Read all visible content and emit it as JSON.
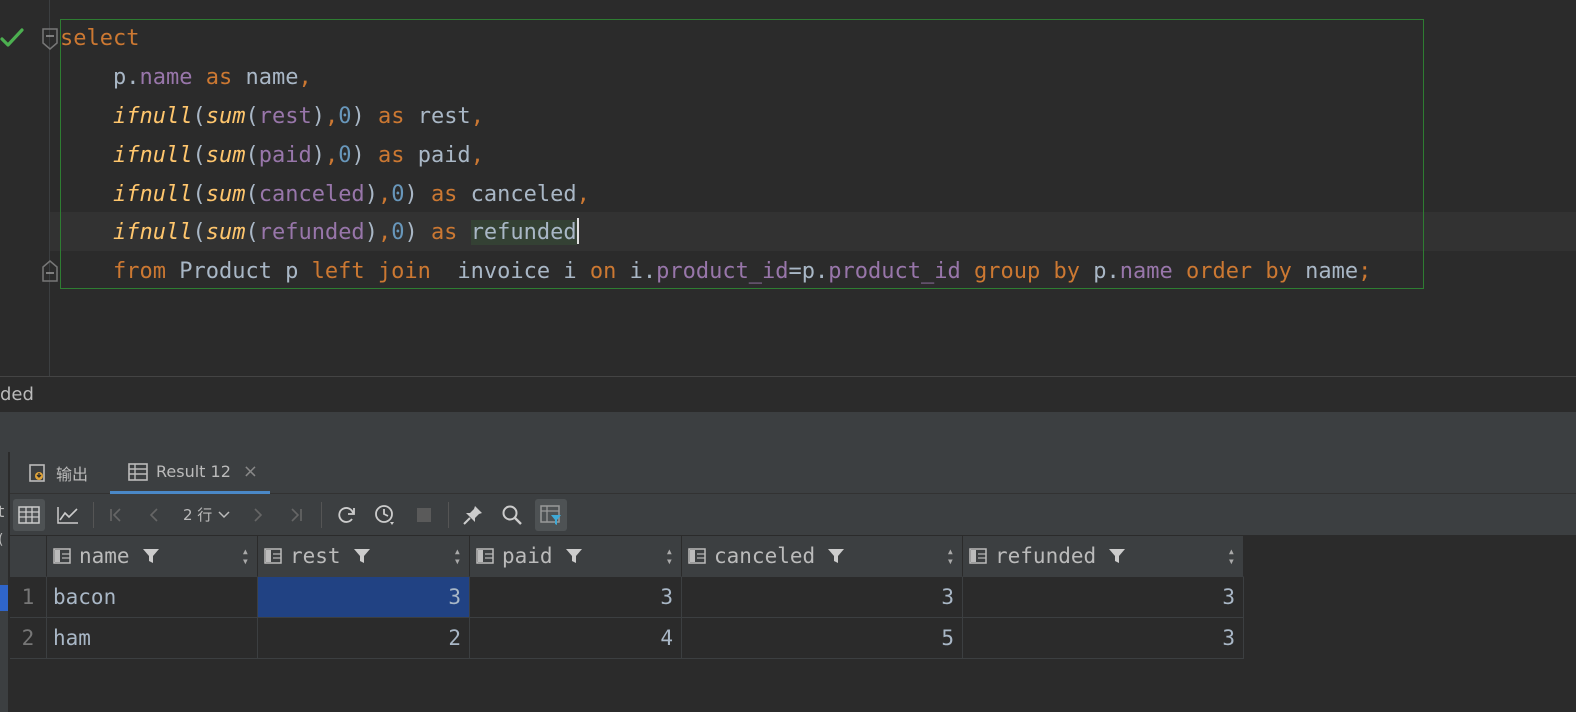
{
  "editor": {
    "status": "success",
    "lines": [
      [
        {
          "t": "select",
          "c": "kw"
        }
      ],
      [
        {
          "t": "    p.",
          "c": "pl"
        },
        {
          "t": "name",
          "c": "col"
        },
        {
          "t": " ",
          "c": "pl"
        },
        {
          "t": "as",
          "c": "kw"
        },
        {
          "t": " name",
          "c": "pl"
        },
        {
          "t": ",",
          "c": "kw"
        }
      ],
      [
        {
          "t": "    ",
          "c": "pl"
        },
        {
          "t": "ifnull",
          "c": "fn"
        },
        {
          "t": "(",
          "c": "pl"
        },
        {
          "t": "sum",
          "c": "fn"
        },
        {
          "t": "(",
          "c": "pl"
        },
        {
          "t": "rest",
          "c": "col"
        },
        {
          "t": ")",
          "c": "pl"
        },
        {
          "t": ",",
          "c": "kw"
        },
        {
          "t": "0",
          "c": "num"
        },
        {
          "t": ") ",
          "c": "pl"
        },
        {
          "t": "as",
          "c": "kw"
        },
        {
          "t": " rest",
          "c": "pl"
        },
        {
          "t": ",",
          "c": "kw"
        }
      ],
      [
        {
          "t": "    ",
          "c": "pl"
        },
        {
          "t": "ifnull",
          "c": "fn"
        },
        {
          "t": "(",
          "c": "pl"
        },
        {
          "t": "sum",
          "c": "fn"
        },
        {
          "t": "(",
          "c": "pl"
        },
        {
          "t": "paid",
          "c": "col"
        },
        {
          "t": ")",
          "c": "pl"
        },
        {
          "t": ",",
          "c": "kw"
        },
        {
          "t": "0",
          "c": "num"
        },
        {
          "t": ") ",
          "c": "pl"
        },
        {
          "t": "as",
          "c": "kw"
        },
        {
          "t": " paid",
          "c": "pl"
        },
        {
          "t": ",",
          "c": "kw"
        }
      ],
      [
        {
          "t": "    ",
          "c": "pl"
        },
        {
          "t": "ifnull",
          "c": "fn"
        },
        {
          "t": "(",
          "c": "pl"
        },
        {
          "t": "sum",
          "c": "fn"
        },
        {
          "t": "(",
          "c": "pl"
        },
        {
          "t": "canceled",
          "c": "col"
        },
        {
          "t": ")",
          "c": "pl"
        },
        {
          "t": ",",
          "c": "kw"
        },
        {
          "t": "0",
          "c": "num"
        },
        {
          "t": ") ",
          "c": "pl"
        },
        {
          "t": "as",
          "c": "kw"
        },
        {
          "t": " canceled",
          "c": "pl"
        },
        {
          "t": ",",
          "c": "kw"
        }
      ],
      [
        {
          "t": "    ",
          "c": "pl"
        },
        {
          "t": "ifnull",
          "c": "fn"
        },
        {
          "t": "(",
          "c": "pl"
        },
        {
          "t": "sum",
          "c": "fn"
        },
        {
          "t": "(",
          "c": "pl"
        },
        {
          "t": "refunded",
          "c": "col"
        },
        {
          "t": ")",
          "c": "pl"
        },
        {
          "t": ",",
          "c": "kw"
        },
        {
          "t": "0",
          "c": "num"
        },
        {
          "t": ") ",
          "c": "pl"
        },
        {
          "t": "as",
          "c": "kw"
        },
        {
          "t": " ",
          "c": "pl"
        },
        {
          "t": "refunded",
          "c": "pl hl"
        },
        {
          "t": "|",
          "c": "caret"
        }
      ],
      [
        {
          "t": "    ",
          "c": "pl"
        },
        {
          "t": "from",
          "c": "kw"
        },
        {
          "t": " Product p ",
          "c": "pl"
        },
        {
          "t": "left join",
          "c": "kw"
        },
        {
          "t": "  invoice i ",
          "c": "pl"
        },
        {
          "t": "on",
          "c": "kw"
        },
        {
          "t": " i.",
          "c": "pl"
        },
        {
          "t": "product_id",
          "c": "col"
        },
        {
          "t": "=p.",
          "c": "pl"
        },
        {
          "t": "product_id",
          "c": "col"
        },
        {
          "t": " ",
          "c": "pl"
        },
        {
          "t": "group by",
          "c": "kw"
        },
        {
          "t": " p.",
          "c": "pl"
        },
        {
          "t": "name",
          "c": "col"
        },
        {
          "t": " ",
          "c": "pl"
        },
        {
          "t": "order by",
          "c": "kw"
        },
        {
          "t": " name",
          "c": "pl"
        },
        {
          "t": ";",
          "c": "kw"
        }
      ]
    ]
  },
  "status_strip": {
    "text": "ded"
  },
  "panel": {
    "left_stub_top": "t",
    "left_stub_mid": "(",
    "tabs": [
      {
        "label": "输出",
        "icon": "output-icon"
      },
      {
        "label": "Result 12",
        "icon": "table-icon",
        "close": "×"
      }
    ],
    "toolbar": {
      "rows_label": "2 行",
      "buttons": [
        "table-view-icon",
        "chart-view-icon",
        "first-page-icon",
        "prev-page-icon",
        "next-page-icon",
        "last-page-icon",
        "reload-icon",
        "history-icon",
        "stop-icon",
        "pin-icon",
        "search-icon",
        "filter-view-icon"
      ]
    },
    "grid": {
      "columns": [
        "name",
        "rest",
        "paid",
        "canceled",
        "refunded"
      ],
      "rows": [
        {
          "num": "1",
          "cells": [
            "bacon",
            "3",
            "3",
            "3",
            "3"
          ]
        },
        {
          "num": "2",
          "cells": [
            "ham",
            "2",
            "4",
            "5",
            "3"
          ]
        }
      ],
      "selected_cell": {
        "row": 0,
        "col": 1
      }
    }
  },
  "colors": {
    "keyword": "#cc7832",
    "function": "#ffc66d",
    "column": "#9876aa",
    "number": "#6897bb",
    "selection": "#214283",
    "statement_border": "#2e7d32"
  }
}
